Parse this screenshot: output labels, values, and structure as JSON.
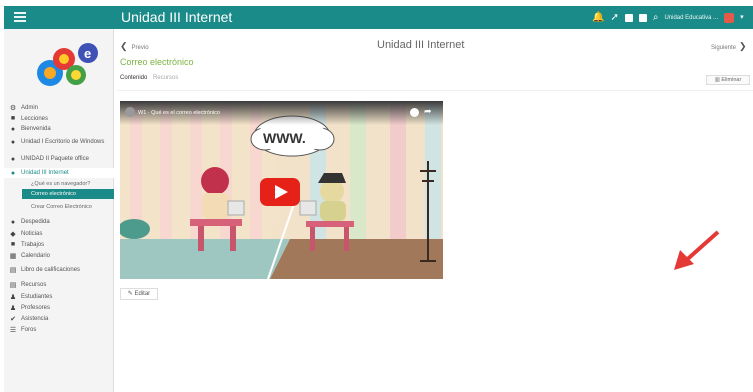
{
  "app": {
    "title": "Unidad III Internet"
  },
  "header": {
    "user_label": "Unidad Educativa ...",
    "icons": [
      "bell-icon",
      "rocket-icon",
      "grid-icon",
      "calendar-icon",
      "search-icon",
      "avatar"
    ]
  },
  "sidebar": {
    "items": [
      {
        "icon": "⚙",
        "label": "Admin"
      },
      {
        "icon": "■",
        "label": "Lecciones"
      },
      {
        "icon": "●",
        "label": "Bienvenida"
      },
      {
        "icon": "●",
        "label": "Unidad I Escritorio de Windows"
      },
      {
        "icon": "●",
        "label": "UNIDAD II Paquete office"
      },
      {
        "icon": "●",
        "label": "Unidad III Internet",
        "active": true
      },
      {
        "label": "¿Qué es un navegador?",
        "sub": true
      },
      {
        "label": "Correo electrónico",
        "sub": true,
        "current": true
      },
      {
        "label": "Crear Correo Electrónico",
        "sub": true
      },
      {
        "icon": "●",
        "label": "Despedida"
      },
      {
        "icon": "◆",
        "label": "Noticias"
      },
      {
        "icon": "■",
        "label": "Trabajos"
      },
      {
        "icon": "▦",
        "label": "Calendario"
      },
      {
        "icon": "▤",
        "label": "Libro de calificaciones"
      },
      {
        "icon": "▤",
        "label": "Recursos"
      },
      {
        "icon": "♟",
        "label": "Estudiantes"
      },
      {
        "icon": "♟",
        "label": "Profesores"
      },
      {
        "icon": "✔",
        "label": "Asistencia"
      },
      {
        "icon": "☰",
        "label": "Foros"
      }
    ]
  },
  "content": {
    "prev_label": "Previo",
    "page_title": "Unidad III Internet",
    "next_label": "Siguiente",
    "subtitle": "Correo electrónico",
    "tabs": [
      "Contenido",
      "Recursos"
    ],
    "edit_button": "Eliminar",
    "video_title": "W1 · Qué es el correo electrónico",
    "video_sign": "WWW.",
    "edit_link": "Editar"
  },
  "colors": {
    "accent": "#1b8b89",
    "subtitle": "#7cb342",
    "youtube": "#e62117",
    "arrow": "#e53935"
  }
}
